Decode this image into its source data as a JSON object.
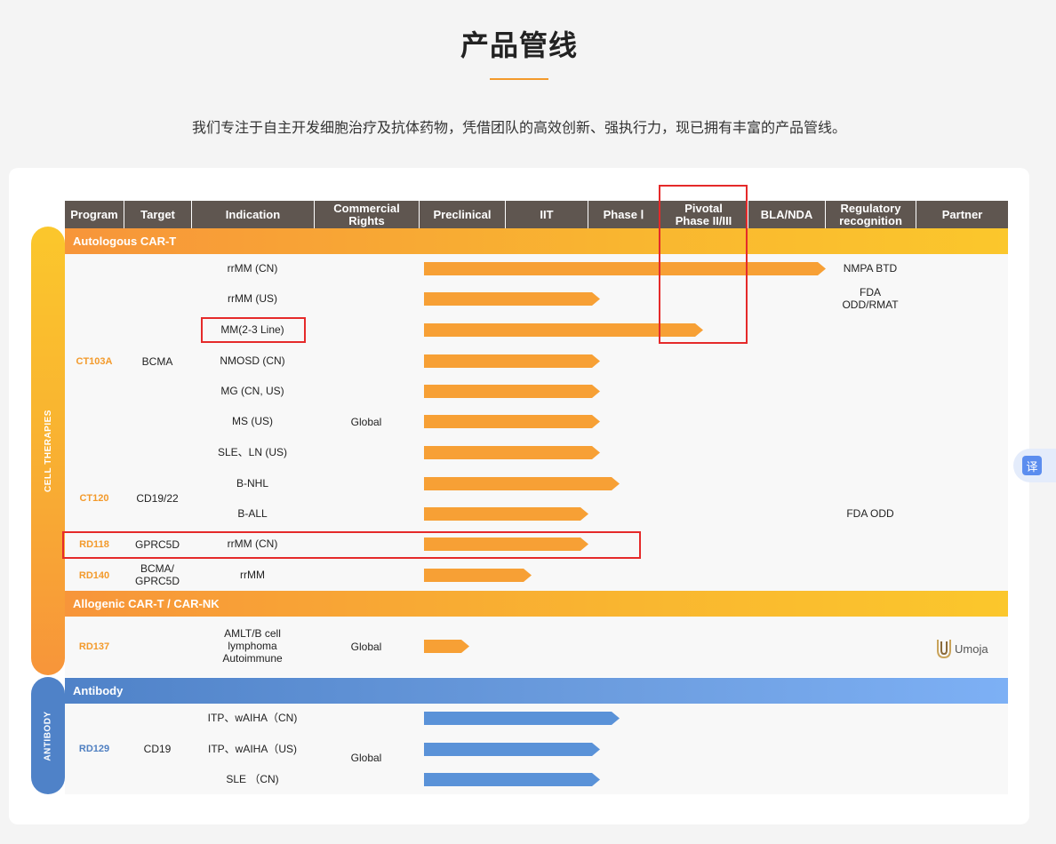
{
  "title": "产品管线",
  "subtitle": "我们专注于自主开发细胞治疗及抗体药物，凭借团队的高效创新、强执行力，现已拥有丰富的产品管线。",
  "colors": {
    "accent": "#f39a2b",
    "header_bg": "#5f5650",
    "orange": "#f7a035",
    "blue": "#5a92d8",
    "highlight": "#e52a2a"
  },
  "headers": [
    "Program",
    "Target",
    "Indication",
    "Commercial\nRights",
    "Preclinical",
    "IIT",
    "Phase Ⅰ",
    "Pivotal\nPhase II/III",
    "BLA/NDA",
    "Regulatory\nrecognition",
    "Partner"
  ],
  "side_labels": {
    "cell": "CELL THERAPIES",
    "antibody": "ANTIBODY"
  },
  "sections": {
    "autologous": "Autologous CAR-T",
    "allogenic": "Allogenic CAR-T / CAR-NK",
    "antibody": "Antibody"
  },
  "programs": {
    "ct103a": {
      "name": "CT103A",
      "target": "BCMA",
      "rights": "Global"
    },
    "ct120": {
      "name": "CT120",
      "target": "CD19/22"
    },
    "rd118": {
      "name": "RD118",
      "target": "GPRC5D"
    },
    "rd140": {
      "name": "RD140",
      "target": "BCMA/\nGPRC5D"
    },
    "rd137": {
      "name": "RD137",
      "rights": "Global",
      "partner": "Umoja"
    },
    "rd129": {
      "name": "RD129",
      "target": "CD19",
      "rights": "Global"
    }
  },
  "rows": [
    {
      "indication": "rrMM (CN)",
      "bar_end": "BLA/NDA",
      "bar_fill": 1.0,
      "recognition": "NMPA BTD"
    },
    {
      "indication": "rrMM (US)",
      "bar_end": "Phase Ⅰ",
      "bar_fill": 0.6,
      "recognition": "FDA\nODD/RMAT"
    },
    {
      "indication": "MM(2-3 Line)",
      "bar_end": "Pivotal Phase II/III",
      "bar_fill": 0.7,
      "recognition": ""
    },
    {
      "indication": "NMOSD (CN)",
      "bar_end": "Phase Ⅰ",
      "bar_fill": 0.6,
      "recognition": ""
    },
    {
      "indication": "MG (CN, US)",
      "bar_end": "Phase Ⅰ",
      "bar_fill": 0.6,
      "recognition": ""
    },
    {
      "indication": "MS (US)",
      "bar_end": "Phase Ⅰ",
      "bar_fill": 0.6,
      "recognition": ""
    },
    {
      "indication": "SLE、LN (US)",
      "bar_end": "Phase Ⅰ",
      "bar_fill": 0.6,
      "recognition": ""
    },
    {
      "indication": "B-NHL",
      "bar_end": "Phase Ⅰ",
      "bar_fill": 0.9,
      "recognition": ""
    },
    {
      "indication": "B-ALL",
      "bar_end": "Phase Ⅰ",
      "bar_fill": 0.0,
      "recognition": "FDA ODD"
    },
    {
      "indication": "rrMM (CN)",
      "bar_end": "Phase Ⅰ",
      "bar_fill": 0.0,
      "recognition": ""
    },
    {
      "indication": "rrMM",
      "bar_end": "IIT",
      "bar_fill": 0.3,
      "recognition": ""
    },
    {
      "indication": "AMLT/B cell\nlymphoma\nAutoimmune",
      "bar_end": "Preclinical",
      "bar_fill": 0.5,
      "recognition": ""
    },
    {
      "indication": "ITP、wAIHA（CN)",
      "bar_end": "Phase Ⅰ",
      "bar_fill": 0.9,
      "recognition": ""
    },
    {
      "indication": "ITP、wAIHA（US)",
      "bar_end": "Phase Ⅰ",
      "bar_fill": 0.6,
      "recognition": ""
    },
    {
      "indication": "SLE （CN)",
      "bar_end": "Phase Ⅰ",
      "bar_fill": 0.6,
      "recognition": ""
    }
  ],
  "translate_icon": "译"
}
